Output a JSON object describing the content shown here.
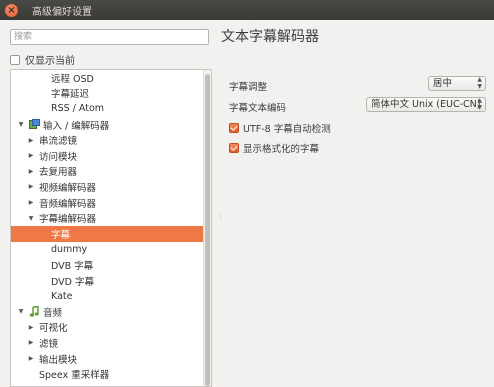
{
  "window": {
    "title": "高级偏好设置",
    "close_glyph": "×"
  },
  "left": {
    "search_placeholder": "搜索",
    "show_current_only": {
      "label": "仅显示当前",
      "checked": false
    },
    "tree": [
      {
        "label": "远程 OSD",
        "level": 2,
        "arrow": "",
        "icon": ""
      },
      {
        "label": "字幕延迟",
        "level": 2,
        "arrow": "",
        "icon": ""
      },
      {
        "label": "RSS / Atom",
        "level": 2,
        "arrow": "",
        "icon": ""
      },
      {
        "label": "输入 / 编解码器",
        "level": 0,
        "arrow": "▼",
        "icon": "codec-icon"
      },
      {
        "label": "串流滤镜",
        "level": 1,
        "arrow": "▶",
        "icon": ""
      },
      {
        "label": "访问模块",
        "level": 1,
        "arrow": "▶",
        "icon": ""
      },
      {
        "label": "去复用器",
        "level": 1,
        "arrow": "▶",
        "icon": ""
      },
      {
        "label": "视频编解码器",
        "level": 1,
        "arrow": "▶",
        "icon": ""
      },
      {
        "label": "音频编解码器",
        "level": 1,
        "arrow": "▶",
        "icon": ""
      },
      {
        "label": "字幕编解码器",
        "level": 1,
        "arrow": "▼",
        "icon": ""
      },
      {
        "label": "字幕",
        "level": 2,
        "arrow": "",
        "icon": "",
        "selected": true
      },
      {
        "label": "dummy",
        "level": 2,
        "arrow": "",
        "icon": ""
      },
      {
        "label": "DVB 字幕",
        "level": 2,
        "arrow": "",
        "icon": ""
      },
      {
        "label": "DVD 字幕",
        "level": 2,
        "arrow": "",
        "icon": ""
      },
      {
        "label": "Kate",
        "level": 2,
        "arrow": "",
        "icon": ""
      },
      {
        "label": "音频",
        "level": 0,
        "arrow": "▼",
        "icon": "music-note-icon"
      },
      {
        "label": "可视化",
        "level": 1,
        "arrow": "▶",
        "icon": ""
      },
      {
        "label": "滤镜",
        "level": 1,
        "arrow": "▶",
        "icon": ""
      },
      {
        "label": "输出模块",
        "level": 1,
        "arrow": "▶",
        "icon": ""
      },
      {
        "label": "Speex 重采样器",
        "level": 1,
        "arrow": "",
        "icon": ""
      }
    ]
  },
  "right": {
    "section_title": "文本字幕解码器",
    "subtitle_justification": {
      "label": "字幕调整",
      "value": "居中"
    },
    "subtitle_text_encoding": {
      "label": "字幕文本编码",
      "value": "简体中文 Unix (EUC-CN)"
    },
    "utf8_autodetect": {
      "label": "UTF-8 字幕自动检测",
      "checked": true
    },
    "formatted_subtitles": {
      "label": "显示格式化的字幕",
      "checked": true
    }
  },
  "colors": {
    "accent": "#f07746",
    "titlebar": "#3b3a36",
    "close": "#e3592a"
  }
}
